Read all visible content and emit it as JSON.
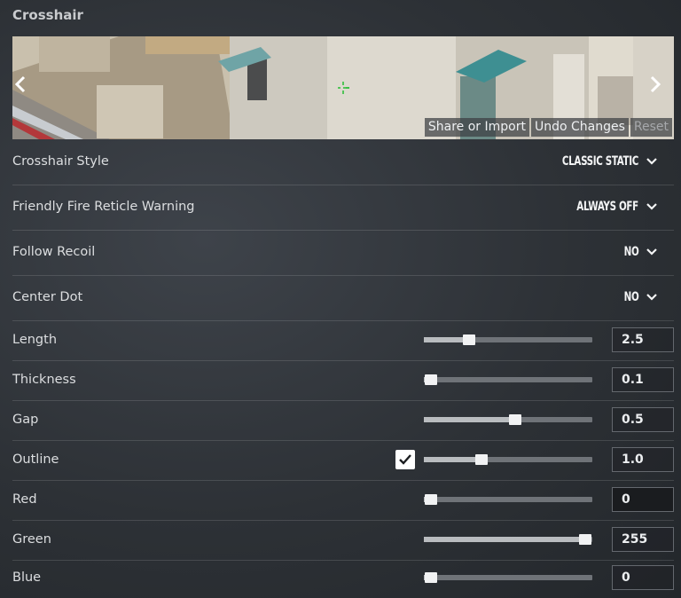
{
  "section_title": "Crosshair",
  "preview": {
    "prev_icon": "chevron-left-icon",
    "next_icon": "chevron-right-icon",
    "share_import_label": "Share or Import",
    "undo_label": "Undo Changes",
    "reset_label": "Reset"
  },
  "dropdowns": [
    {
      "label": "Crosshair Style",
      "value": "CLASSIC STATIC"
    },
    {
      "label": "Friendly Fire Reticle Warning",
      "value": "ALWAYS OFF"
    },
    {
      "label": "Follow Recoil",
      "value": "NO"
    },
    {
      "label": "Center Dot",
      "value": "NO"
    }
  ],
  "sliders": [
    {
      "label": "Length",
      "value": "2.5",
      "fraction": 0.27
    },
    {
      "label": "Thickness",
      "value": "0.1",
      "fraction": 0.04
    },
    {
      "label": "Gap",
      "value": "0.5",
      "fraction": 0.54
    },
    {
      "label": "Outline",
      "value": "1.0",
      "fraction": 0.34,
      "checked": true
    },
    {
      "label": "Red",
      "value": "0",
      "fraction": 0.04
    },
    {
      "label": "Green",
      "value": "255",
      "fraction": 0.96
    },
    {
      "label": "Blue",
      "value": "0",
      "fraction": 0.04
    }
  ],
  "colors": {
    "crosshair": "#2fbf3a",
    "background": "#2d3136"
  }
}
